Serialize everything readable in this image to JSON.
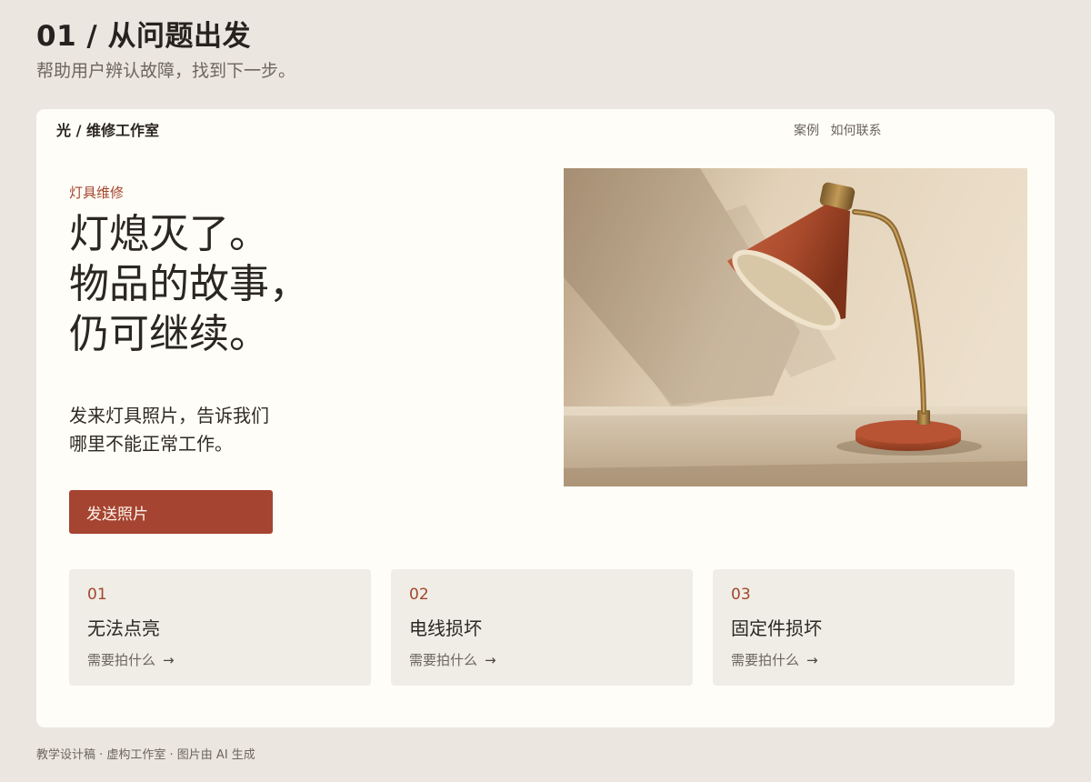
{
  "page": {
    "title": "01 / 从问题出发",
    "subtitle": "帮助用户辨认故障，找到下一步。"
  },
  "site": {
    "brand": "光 / 维修工作室",
    "nav": [
      {
        "label": "案例"
      },
      {
        "label": "如何联系"
      }
    ]
  },
  "hero": {
    "eyebrow": "灯具维修",
    "headline_lines": [
      "灯熄灭了。",
      "物品的故事，",
      "仍可继续。"
    ],
    "intro_lines": [
      "发来灯具照片，告诉我们",
      "哪里不能正常工作。"
    ],
    "cta_label": "发送照片",
    "image_icon": "desk-lamp-photo"
  },
  "issues": [
    {
      "number": "01",
      "title": "无法点亮",
      "link": "需要拍什么",
      "arrow": "→"
    },
    {
      "number": "02",
      "title": "电线损坏",
      "link": "需要拍什么",
      "arrow": "→"
    },
    {
      "number": "03",
      "title": "固定件损坏",
      "link": "需要拍什么",
      "arrow": "→"
    }
  ],
  "footer": {
    "note": "教学设计稿 · 虚构工作室 · 图片由 AI 生成"
  },
  "colors": {
    "page_background": "#ebe6e0",
    "card_background": "#fffdf7",
    "accent": "#a54430",
    "issue_card_background": "#efede6"
  }
}
